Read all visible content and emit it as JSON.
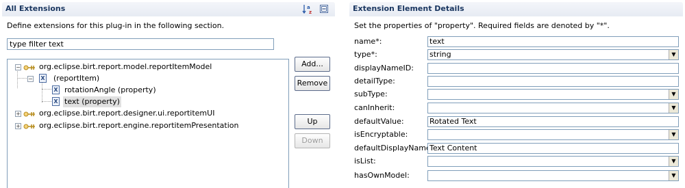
{
  "left_panel": {
    "title": "All Extensions",
    "description": "Define extensions for this plug-in in the following section.",
    "filter_value": "type filter text",
    "tree": [
      {
        "label": "org.eclipse.birt.report.model.reportItemModel",
        "expanded": true
      },
      {
        "label": "(reportItem)",
        "expanded": true
      },
      {
        "label": "rotationAngle (property)"
      },
      {
        "label": "text (property)",
        "selected": true
      },
      {
        "label": "org.eclipse.birt.report.designer.ui.reportitemUI",
        "expanded": false
      },
      {
        "label": "org.eclipse.birt.report.engine.reportitemPresentation",
        "expanded": false
      }
    ],
    "buttons": {
      "add": "Add...",
      "remove": "Remove",
      "up": "Up",
      "down": "Down"
    },
    "toolbar": {
      "sort_icon": "sort-az-icon",
      "collapse_icon": "collapse-all-icon"
    }
  },
  "right_panel": {
    "title": "Extension Element Details",
    "description": "Set the properties of \"property\". Required fields are denoted by \"*\".",
    "fields": [
      {
        "label": "name*:",
        "value": "text",
        "type": "text"
      },
      {
        "label": "type*:",
        "value": "string",
        "type": "combo"
      },
      {
        "label": "displayNameID:",
        "value": "",
        "type": "text"
      },
      {
        "label": "detailType:",
        "value": "",
        "type": "text"
      },
      {
        "label": "subType:",
        "value": "",
        "type": "combo"
      },
      {
        "label": "canInherit:",
        "value": "",
        "type": "combo"
      },
      {
        "label": "defaultValue:",
        "value": "Rotated Text",
        "type": "text"
      },
      {
        "label": "isEncryptable:",
        "value": "",
        "type": "combo"
      },
      {
        "label": "defaultDisplayName:",
        "value": "Text Content",
        "type": "text"
      },
      {
        "label": "isList:",
        "value": "",
        "type": "combo"
      },
      {
        "label": "hasOwnModel:",
        "value": "",
        "type": "combo"
      }
    ]
  }
}
